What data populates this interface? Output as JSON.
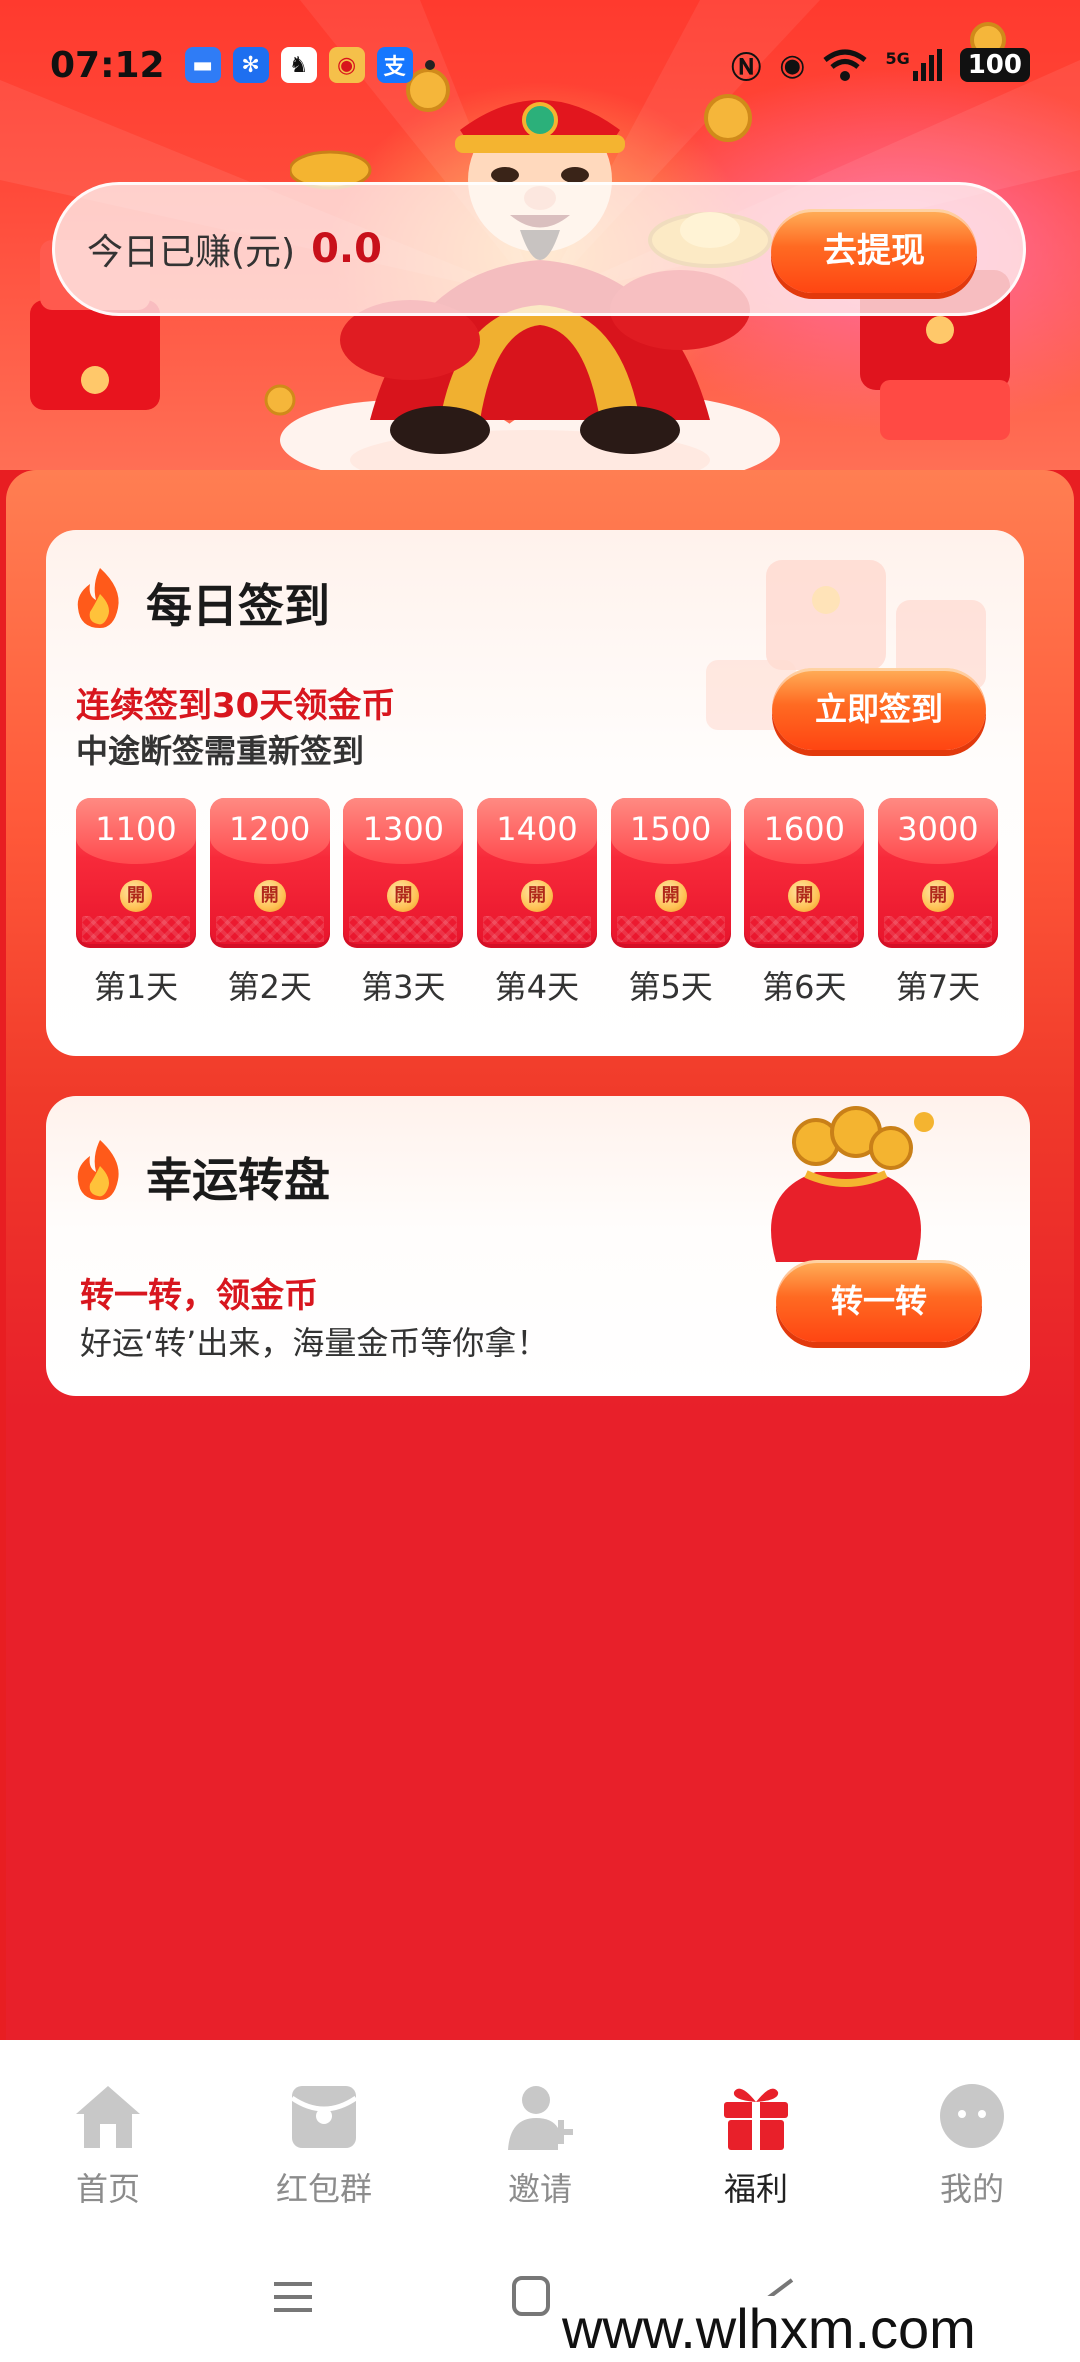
{
  "status_bar": {
    "time": "07:12",
    "notification_icons": [
      {
        "name": "message-icon",
        "color": "#2f7cf6",
        "glyph": "▭"
      },
      {
        "name": "fan-app-icon",
        "color": "#1e6ff0",
        "glyph": "✻"
      },
      {
        "name": "qq-icon",
        "color": "#111111",
        "glyph": "♟"
      },
      {
        "name": "weibo-icon",
        "color": "#f0a23a",
        "glyph": "◉"
      },
      {
        "name": "alipay-icon",
        "color": "#1677ff",
        "glyph": "支"
      }
    ],
    "signal_label": "5G",
    "battery": "100"
  },
  "hero": {
    "earn_label": "今日已赚(元)",
    "earn_value": "0.0",
    "withdraw_label": "去提现"
  },
  "checkin": {
    "title": "每日签到",
    "line1": "连续签到30天领金币",
    "line2": "中途断签需重新签到",
    "button": "立即签到",
    "seal_char": "開",
    "days": [
      {
        "amount": "1100",
        "label": "第1天"
      },
      {
        "amount": "1200",
        "label": "第2天"
      },
      {
        "amount": "1300",
        "label": "第3天"
      },
      {
        "amount": "1400",
        "label": "第4天"
      },
      {
        "amount": "1500",
        "label": "第5天"
      },
      {
        "amount": "1600",
        "label": "第6天"
      },
      {
        "amount": "3000",
        "label": "第7天"
      }
    ]
  },
  "wheel": {
    "title": "幸运转盘",
    "line1": "转一转，领金币",
    "line2": "好运‘转’出来，海量金币等你拿！",
    "button": "转一转"
  },
  "bottom_nav": {
    "items": [
      {
        "label": "首页",
        "icon": "home-icon",
        "active": false
      },
      {
        "label": "红包群",
        "icon": "red-packet-group-icon",
        "active": false
      },
      {
        "label": "邀请",
        "icon": "invite-user-icon",
        "active": false
      },
      {
        "label": "福利",
        "icon": "gift-icon",
        "active": true
      },
      {
        "label": "我的",
        "icon": "profile-face-icon",
        "active": false
      }
    ]
  },
  "watermark": "www.wlhxm.com",
  "colors": {
    "primary_red": "#e8202a",
    "accent_orange": "#ff5a1a",
    "active_nav": "#e8202a",
    "inactive_nav": "#c8c8c8"
  }
}
